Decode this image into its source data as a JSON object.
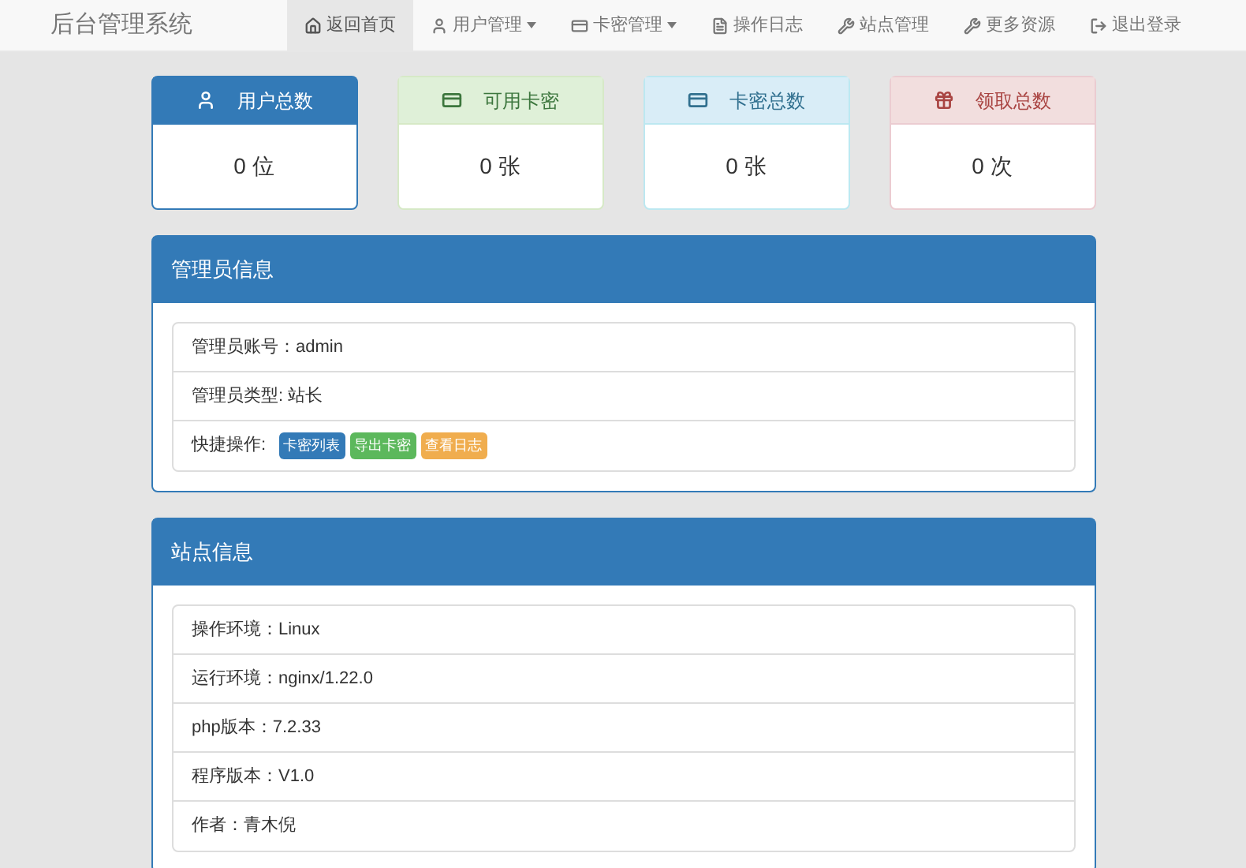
{
  "brand": "后台管理系统",
  "nav": [
    {
      "label": "返回首页",
      "dropdown": false,
      "selected": true
    },
    {
      "label": "用户管理",
      "dropdown": true,
      "selected": false
    },
    {
      "label": "卡密管理",
      "dropdown": true,
      "selected": false
    },
    {
      "label": "操作日志",
      "dropdown": false,
      "selected": false
    },
    {
      "label": "站点管理",
      "dropdown": false,
      "selected": false
    },
    {
      "label": "更多资源",
      "dropdown": false,
      "selected": false
    },
    {
      "label": "退出登录",
      "dropdown": false,
      "selected": false
    }
  ],
  "stats": [
    {
      "kind": "primary",
      "title": "用户总数",
      "value": "0 位"
    },
    {
      "kind": "success",
      "title": "可用卡密",
      "value": "0 张"
    },
    {
      "kind": "info",
      "title": "卡密总数",
      "value": "0 张"
    },
    {
      "kind": "danger",
      "title": "领取总数",
      "value": "0 次"
    }
  ],
  "admin_panel": {
    "title": "管理员信息",
    "rows": [
      {
        "text": "管理员账号：admin"
      },
      {
        "text": "管理员类型: 站长"
      }
    ],
    "quick": {
      "label": "快捷操作:",
      "buttons": [
        {
          "label": "卡密列表",
          "kind": "primary"
        },
        {
          "label": "导出卡密",
          "kind": "success"
        },
        {
          "label": "查看日志",
          "kind": "warning"
        }
      ]
    }
  },
  "site_panel": {
    "title": "站点信息",
    "rows": [
      {
        "text": "操作环境：Linux"
      },
      {
        "text": "运行环境：nginx/1.22.0"
      },
      {
        "text": "php版本：7.2.33"
      },
      {
        "text": "程序版本：V1.0"
      },
      {
        "text": "作者：青木倪"
      }
    ]
  }
}
